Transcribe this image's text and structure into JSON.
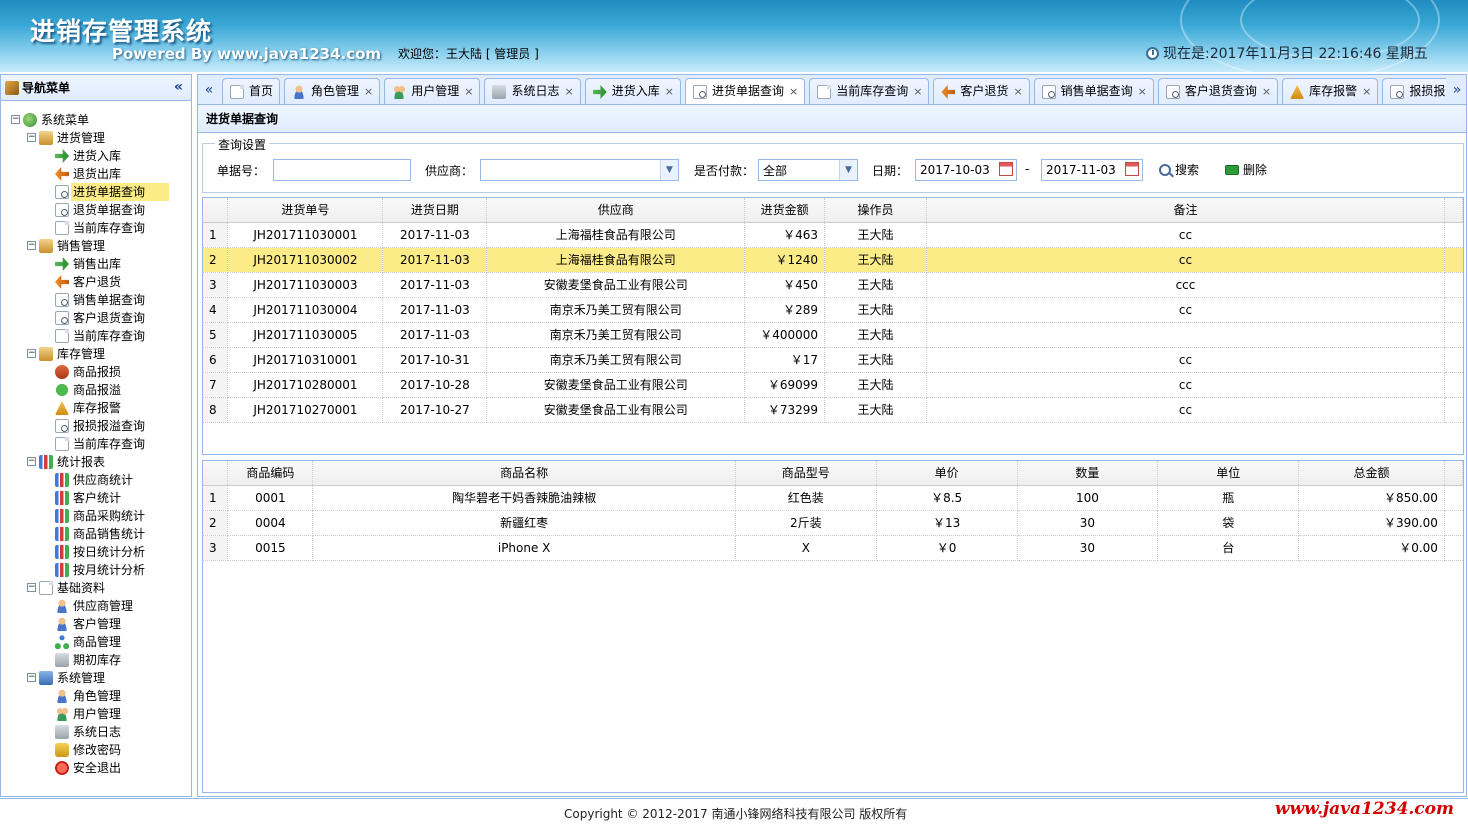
{
  "header": {
    "title": "进销存管理系统",
    "subtitle": "Powered By www.java1234.com",
    "welcome": "欢迎您：王大陆 [ 管理员 ]",
    "clock": "现在是:2017年11月3日 22:16:46 星期五"
  },
  "nav": {
    "title": "导航菜单",
    "collapse": "«",
    "tree": [
      {
        "label": "系统菜单",
        "level": 0,
        "icon": "root",
        "box": "−"
      },
      {
        "label": "进货管理",
        "level": 1,
        "icon": "folder",
        "box": "−"
      },
      {
        "label": "进货入库",
        "level": 2,
        "icon": "green"
      },
      {
        "label": "退货出库",
        "level": 2,
        "icon": "orange"
      },
      {
        "label": "进货单据查询",
        "level": 2,
        "icon": "search",
        "selected": true
      },
      {
        "label": "退货单据查询",
        "level": 2,
        "icon": "search"
      },
      {
        "label": "当前库存查询",
        "level": 2,
        "icon": "page"
      },
      {
        "label": "销售管理",
        "level": 1,
        "icon": "folder",
        "box": "−"
      },
      {
        "label": "销售出库",
        "level": 2,
        "icon": "green"
      },
      {
        "label": "客户退货",
        "level": 2,
        "icon": "orange"
      },
      {
        "label": "销售单据查询",
        "level": 2,
        "icon": "search"
      },
      {
        "label": "客户退货查询",
        "level": 2,
        "icon": "search"
      },
      {
        "label": "当前库存查询",
        "level": 2,
        "icon": "page"
      },
      {
        "label": "库存管理",
        "level": 1,
        "icon": "folder",
        "box": "−"
      },
      {
        "label": "商品报损",
        "level": 2,
        "icon": "stamp"
      },
      {
        "label": "商品报溢",
        "level": 2,
        "icon": "add"
      },
      {
        "label": "库存报警",
        "level": 2,
        "icon": "warn"
      },
      {
        "label": "报损报溢查询",
        "level": 2,
        "icon": "search"
      },
      {
        "label": "当前库存查询",
        "level": 2,
        "icon": "page"
      },
      {
        "label": "统计报表",
        "level": 1,
        "icon": "chart",
        "box": "−"
      },
      {
        "label": "供应商统计",
        "level": 2,
        "icon": "chart"
      },
      {
        "label": "客户统计",
        "level": 2,
        "icon": "chart"
      },
      {
        "label": "商品采购统计",
        "level": 2,
        "icon": "chart"
      },
      {
        "label": "商品销售统计",
        "level": 2,
        "icon": "chart"
      },
      {
        "label": "按日统计分析",
        "level": 2,
        "icon": "chart"
      },
      {
        "label": "按月统计分析",
        "level": 2,
        "icon": "chart"
      },
      {
        "label": "基础资料",
        "level": 1,
        "icon": "page",
        "box": "−"
      },
      {
        "label": "供应商管理",
        "level": 2,
        "icon": "user"
      },
      {
        "label": "客户管理",
        "level": 2,
        "icon": "user"
      },
      {
        "label": "商品管理",
        "level": 2,
        "icon": "tree"
      },
      {
        "label": "期初库存",
        "level": 2,
        "icon": "book"
      },
      {
        "label": "系统管理",
        "level": 1,
        "icon": "monitor",
        "box": "−"
      },
      {
        "label": "角色管理",
        "level": 2,
        "icon": "user"
      },
      {
        "label": "用户管理",
        "level": 2,
        "icon": "users"
      },
      {
        "label": "系统日志",
        "level": 2,
        "icon": "book"
      },
      {
        "label": "修改密码",
        "level": 2,
        "icon": "lock"
      },
      {
        "label": "安全退出",
        "level": 2,
        "icon": "exit"
      }
    ]
  },
  "tabs": {
    "scroll_left": "«",
    "scroll_right": "»",
    "close": "×",
    "items": [
      {
        "label": "首页",
        "icon": "page",
        "closable": false
      },
      {
        "label": "角色管理",
        "icon": "user",
        "closable": true
      },
      {
        "label": "用户管理",
        "icon": "users",
        "closable": true
      },
      {
        "label": "系统日志",
        "icon": "book",
        "closable": true
      },
      {
        "label": "进货入库",
        "icon": "green",
        "closable": true
      },
      {
        "label": "进货单据查询",
        "icon": "search",
        "closable": true,
        "active": true
      },
      {
        "label": "当前库存查询",
        "icon": "page",
        "closable": true
      },
      {
        "label": "客户退货",
        "icon": "orange",
        "closable": true
      },
      {
        "label": "销售单据查询",
        "icon": "search",
        "closable": true
      },
      {
        "label": "客户退货查询",
        "icon": "search",
        "closable": true
      },
      {
        "label": "库存报警",
        "icon": "warn",
        "closable": true
      },
      {
        "label": "报损报",
        "icon": "search",
        "closable": false
      }
    ]
  },
  "panel": {
    "title": "进货单据查询",
    "filter": {
      "legend": "查询设置",
      "order_no_label": "单据号：",
      "order_no_value": "",
      "supplier_label": "供应商：",
      "supplier_value": "",
      "paid_label": "是否付款：",
      "paid_value": "全部",
      "date_label": "日期：",
      "date_from": "2017-10-03",
      "date_sep": "-",
      "date_to": "2017-11-03",
      "search_label": "搜索",
      "delete_label": "删除"
    }
  },
  "orders": {
    "columns": [
      "进货单号",
      "进货日期",
      "供应商",
      "进货金额",
      "操作员",
      "备注"
    ],
    "rows": [
      {
        "n": "1",
        "no": "JH201711030001",
        "date": "2017-11-03",
        "supplier": "上海福桂食品有限公司",
        "amount": "￥463",
        "op": "王大陆",
        "remark": "cc"
      },
      {
        "n": "2",
        "no": "JH201711030002",
        "date": "2017-11-03",
        "supplier": "上海福桂食品有限公司",
        "amount": "￥1240",
        "op": "王大陆",
        "remark": "cc",
        "selected": true
      },
      {
        "n": "3",
        "no": "JH201711030003",
        "date": "2017-11-03",
        "supplier": "安徽麦堡食品工业有限公司",
        "amount": "￥450",
        "op": "王大陆",
        "remark": "ccc"
      },
      {
        "n": "4",
        "no": "JH201711030004",
        "date": "2017-11-03",
        "supplier": "南京禾乃美工贸有限公司",
        "amount": "￥289",
        "op": "王大陆",
        "remark": "cc"
      },
      {
        "n": "5",
        "no": "JH201711030005",
        "date": "2017-11-03",
        "supplier": "南京禾乃美工贸有限公司",
        "amount": "￥400000",
        "op": "王大陆",
        "remark": ""
      },
      {
        "n": "6",
        "no": "JH201710310001",
        "date": "2017-10-31",
        "supplier": "南京禾乃美工贸有限公司",
        "amount": "￥17",
        "op": "王大陆",
        "remark": "cc"
      },
      {
        "n": "7",
        "no": "JH201710280001",
        "date": "2017-10-28",
        "supplier": "安徽麦堡食品工业有限公司",
        "amount": "￥69099",
        "op": "王大陆",
        "remark": "cc"
      },
      {
        "n": "8",
        "no": "JH201710270001",
        "date": "2017-10-27",
        "supplier": "安徽麦堡食品工业有限公司",
        "amount": "￥73299",
        "op": "王大陆",
        "remark": "cc"
      }
    ]
  },
  "items": {
    "columns": [
      "商品编码",
      "商品名称",
      "商品型号",
      "单价",
      "数量",
      "单位",
      "总金额"
    ],
    "rows": [
      {
        "n": "1",
        "code": "0001",
        "name": "陶华碧老干妈香辣脆油辣椒",
        "model": "红色装",
        "price": "￥8.5",
        "qty": "100",
        "unit": "瓶",
        "total": "￥850.00"
      },
      {
        "n": "2",
        "code": "0004",
        "name": "新疆红枣",
        "model": "2斤装",
        "price": "￥13",
        "qty": "30",
        "unit": "袋",
        "total": "￥390.00"
      },
      {
        "n": "3",
        "code": "0015",
        "name": "iPhone X",
        "model": "X",
        "price": "￥0",
        "qty": "30",
        "unit": "台",
        "total": "￥0.00"
      }
    ]
  },
  "footer": {
    "copyright": "Copyright © 2012-2017 南通小锋网络科技有限公司 版权所有",
    "watermark": "www.java1234.com"
  }
}
